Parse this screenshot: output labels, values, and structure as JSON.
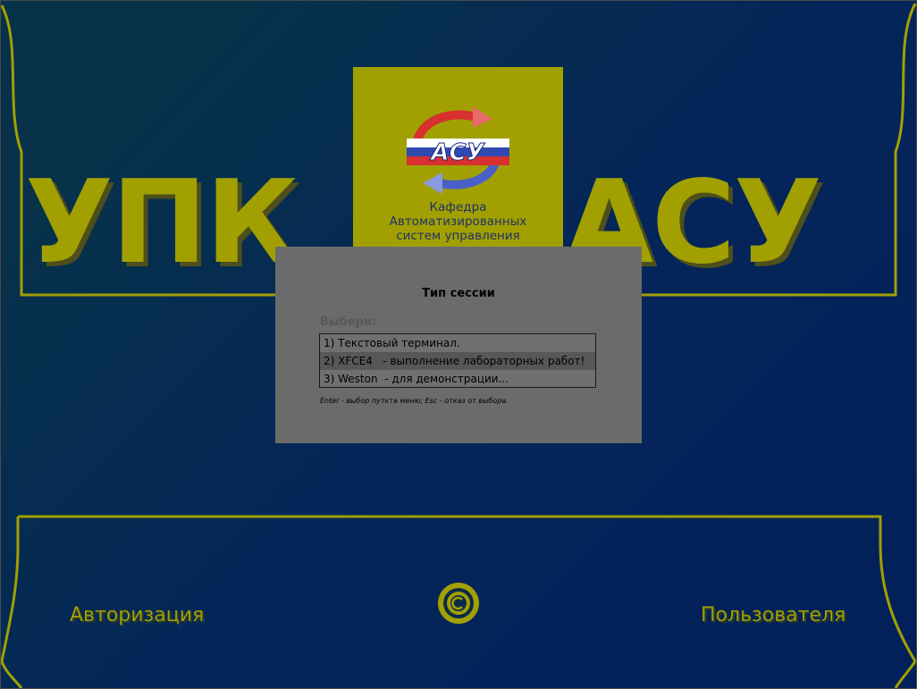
{
  "banner": {
    "left_text": "УПК",
    "right_text": "АСУ"
  },
  "logo": {
    "emblem_text": "АСУ",
    "caption_lines": [
      "Кафедра",
      "Автоматизированных",
      "систем управления"
    ]
  },
  "session_dialog": {
    "title": "Тип сессии",
    "prompt": "Выбери:",
    "options": [
      "1) Текстовый терминал.",
      "2) XFCE4   - выполнение лабораторных работ!",
      "3) Weston  - для демонстрации..."
    ],
    "selected_index": 2,
    "hint": "Enter - выбор путкта меню; Esc - отказ от выбора."
  },
  "footer": {
    "left_label": "Авторизация",
    "right_label": "Пользователя",
    "center_icon": "power-icon"
  },
  "colors": {
    "background_start": "#07324a",
    "background_end": "#02205a",
    "accent_olive": "#a1a000",
    "dialog_background": "#6b6b6b",
    "selected_item": "#575757"
  }
}
